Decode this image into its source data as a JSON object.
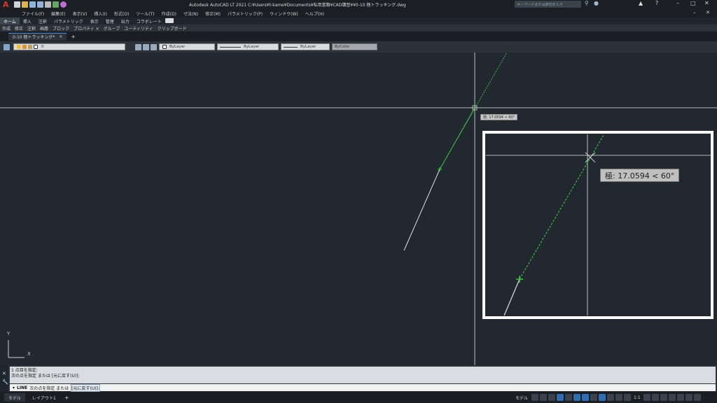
{
  "titlebar": {
    "title": "Autodesk AutoCAD LT 2021    C:¥Users¥t-kame¥Documents¥私用書類¥CAD講習¥¥0-10 極トラッキング.dwg",
    "search_placeholder": "キーワードまたは語句を入力",
    "app_letter": "A"
  },
  "menu": {
    "items": [
      "ファイル(F)",
      "編集(E)",
      "表示(V)",
      "挿入(I)",
      "形式(O)",
      "ツール(T)",
      "作成(D)",
      "寸法(N)",
      "修正(M)",
      "パラメトリック(P)",
      "ウィンドウ(W)",
      "ヘルプ(H)"
    ]
  },
  "ribbon": {
    "tabs": [
      "ホーム",
      "挿入",
      "注釈",
      "パラメトリック",
      "表示",
      "管理",
      "出力",
      "コラボレート"
    ],
    "panels": [
      "作成",
      "修正",
      "注釈",
      "画層",
      "ブロック",
      "プロパティ ×",
      "グループ",
      "ユーティリティ",
      "クリップボード"
    ]
  },
  "doc_tab": {
    "name": "0-10 極トラッキング*",
    "close": "×",
    "add": "+"
  },
  "properties": {
    "layer": "0",
    "color": "ByLayer",
    "linetype": "ByLayer",
    "lineweight": "ByLayer",
    "plotstyle": "ByColor"
  },
  "tooltip": {
    "text": "極: 17.0594 < 60°"
  },
  "zoom_tooltip": {
    "text": "極: 17.0594 < 60°"
  },
  "ucs": {
    "y": "Y",
    "x": "X"
  },
  "command": {
    "history1": "1 点目を指定:",
    "history2": "次の点を指定 または [元に戻す(U)]:",
    "prompt_cmd": "LINE",
    "prompt_text": "次の点を指定 または",
    "prompt_option": "[元に戻す(U)]:"
  },
  "status": {
    "model_tab": "モデル",
    "layout_tab": "レイアウト1",
    "add": "+",
    "model_label": "モデル",
    "scale": "1:1"
  },
  "colors": {
    "bg": "#212830",
    "accent": "#2f6db3",
    "tracking": "#3fd13f"
  }
}
